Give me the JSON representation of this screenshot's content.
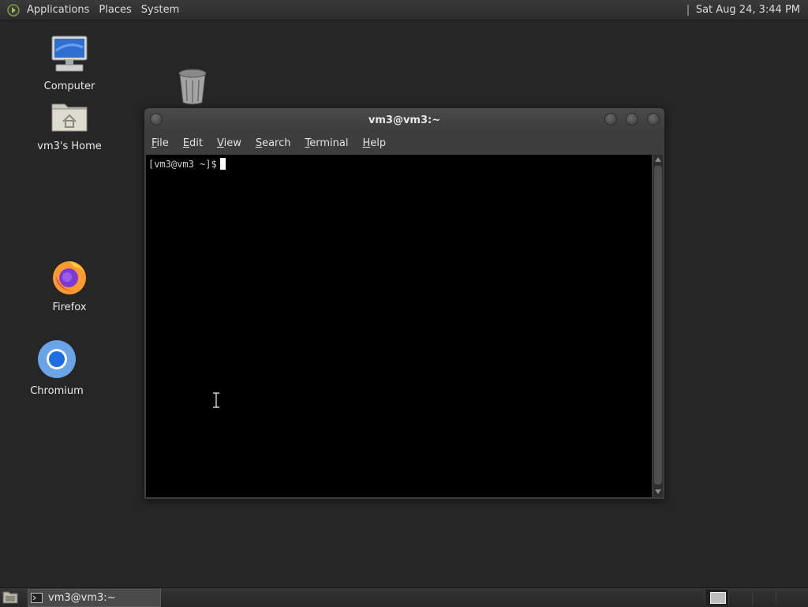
{
  "top_panel": {
    "menus": [
      "Applications",
      "Places",
      "System"
    ],
    "clock": "Sat Aug 24,  3:44 PM"
  },
  "desktop_icons": [
    {
      "label": "Computer",
      "icon": "computer-icon"
    },
    {
      "label": "vm3's Home",
      "icon": "home-folder-icon"
    },
    {
      "label": "",
      "icon": "trash-icon"
    },
    {
      "label": "Firefox",
      "icon": "firefox-icon"
    },
    {
      "label": "Chromium",
      "icon": "chromium-icon"
    }
  ],
  "terminal": {
    "title": "vm3@vm3:~",
    "menu": [
      {
        "label": "File",
        "mnemonic": "F",
        "rest": "ile"
      },
      {
        "label": "Edit",
        "mnemonic": "E",
        "rest": "dit"
      },
      {
        "label": "View",
        "mnemonic": "V",
        "rest": "iew"
      },
      {
        "label": "Search",
        "mnemonic": "S",
        "rest": "earch"
      },
      {
        "label": "Terminal",
        "mnemonic": "T",
        "rest": "erminal"
      },
      {
        "label": "Help",
        "mnemonic": "H",
        "rest": "elp"
      }
    ],
    "prompt": "[vm3@vm3 ~]$"
  },
  "taskbar": {
    "tasks": [
      {
        "label": "vm3@vm3:~",
        "icon": "terminal-icon"
      }
    ],
    "workspaces": 4,
    "active_workspace": 1
  },
  "colors": {
    "desktop": "#262626",
    "terminal_bg": "#000000",
    "panel": "#2c2c2c"
  }
}
